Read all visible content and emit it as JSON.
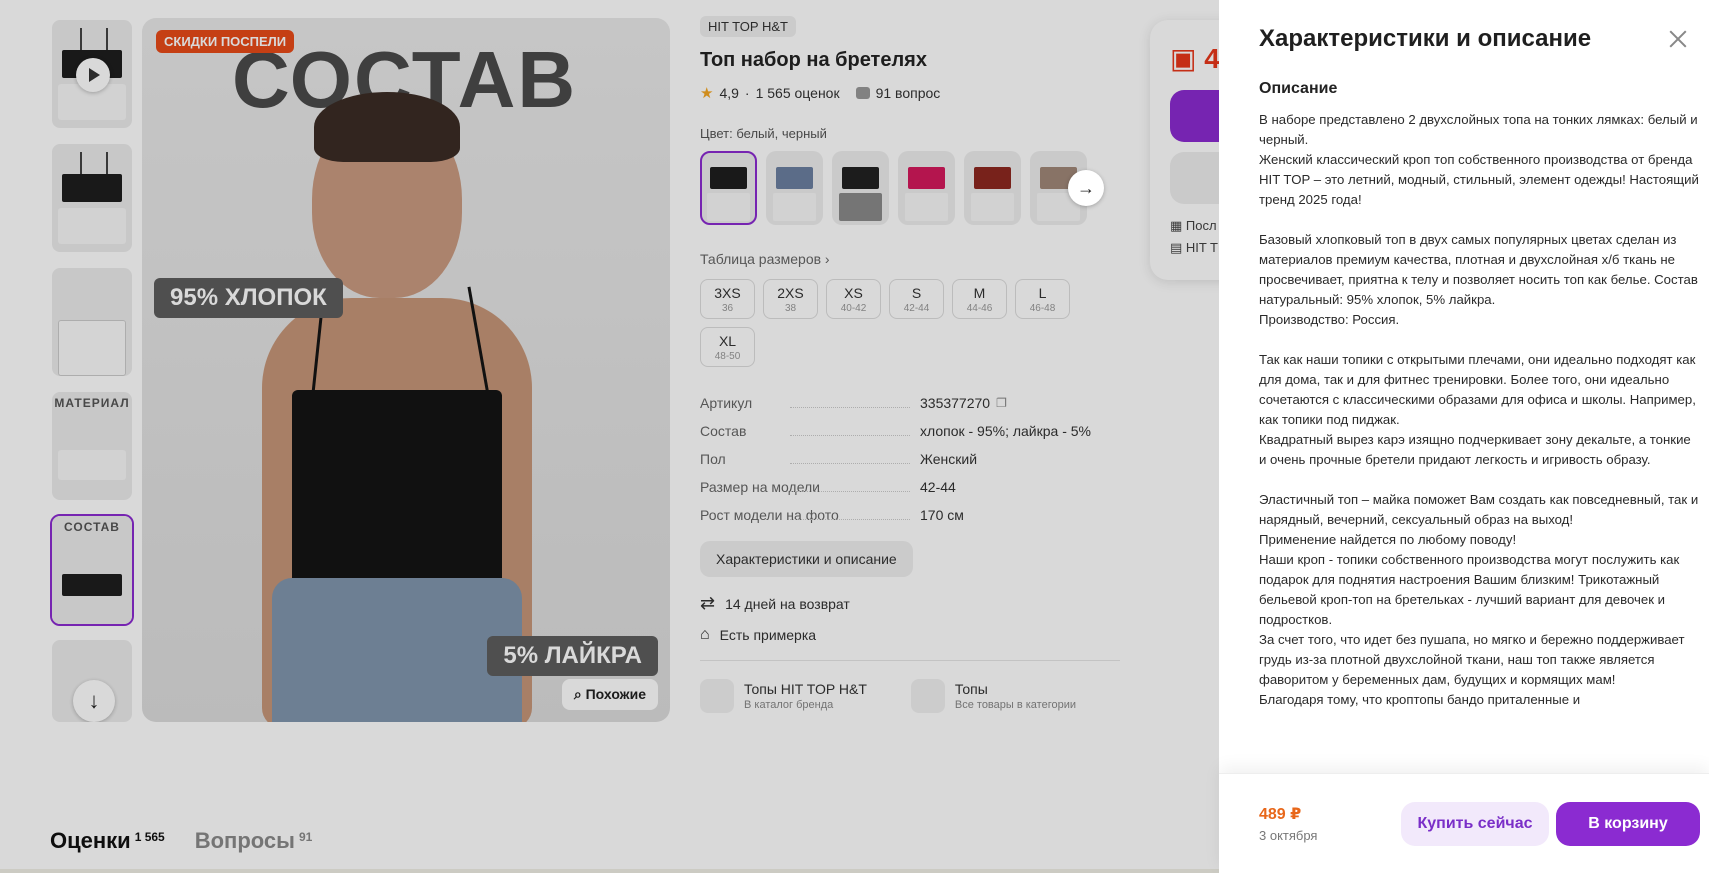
{
  "product": {
    "brand": "HIT TOP H&T",
    "title": "Топ набор на бретелях",
    "rating": "4,9",
    "ratings_count": "1 565 оценок",
    "questions": "91 вопрос",
    "color_label": "Цвет: белый, черный",
    "size_table_link": "Таблица размеров",
    "sizes": [
      {
        "size": "3XS",
        "ru": "36"
      },
      {
        "size": "2XS",
        "ru": "38"
      },
      {
        "size": "XS",
        "ru": "40-42"
      },
      {
        "size": "S",
        "ru": "42-44"
      },
      {
        "size": "M",
        "ru": "44-46"
      },
      {
        "size": "L",
        "ru": "46-48"
      },
      {
        "size": "XL",
        "ru": "48-50"
      }
    ],
    "swatch_colors": [
      "#1e1e1e",
      "#6c7fa0",
      "#222222",
      "#d4195c",
      "#8e2820",
      "#a08878"
    ],
    "specs": [
      {
        "key": "Артикул",
        "value": "335377270"
      },
      {
        "key": "Состав",
        "value": "хлопок - 95%; лайкра - 5%"
      },
      {
        "key": "Пол",
        "value": "Женский"
      },
      {
        "key": "Размер на модели",
        "value": "42-44"
      },
      {
        "key": "Рост модели на фото",
        "value": "170 см"
      }
    ],
    "desc_button": "Характеристики и описание",
    "features": [
      "14 дней на возврат",
      "Есть примерка"
    ],
    "links": [
      {
        "title": "Топы HIT TOP H&T",
        "sub": "В каталог бренда"
      },
      {
        "title": "Топы",
        "sub": "Все товары в категории"
      }
    ]
  },
  "hero": {
    "sale_tag": "СКИДКИ ПОСПЕЛИ",
    "title": "СОСТАВ",
    "badge_cotton": "95% ХЛОПОК",
    "badge_lycra": "5% ЛАЙКРА",
    "similar": "Похожие",
    "thumb_captions": [
      "МАТЕРИАЛ",
      "СОСТАВ"
    ]
  },
  "buybox": {
    "price_partial": "4",
    "line1": "Посл",
    "line2": "HIT T"
  },
  "bottom_tabs": {
    "reviews": "Оценки",
    "reviews_count": "1 565",
    "questions": "Вопросы",
    "questions_count": "91"
  },
  "drawer": {
    "title": "Характеристики и описание",
    "section": "Описание",
    "paragraphs": [
      [
        "В наборе представлено 2 двухслойных топа на тонких лямках: белый и черный.",
        "Женский классический кроп топ собственного производства от бренда HIT TOP – это летний, модный, стильный, элемент одежды! Настоящий тренд 2025 года!"
      ],
      [
        "Базовый хлопковый топ в двух самых популярных цветах сделан из материалов премиум качества, плотная и двухслойная х/б ткань не просвечивает, приятна к телу и позволяет носить топ как белье. Состав натуральный: 95% хлопок, 5% лайкра.",
        "Производство: Россия."
      ],
      [
        "Так как наши топики с открытыми плечами, они идеально подходят как для дома, так и для фитнес тренировки. Более того, они идеально сочетаются с классическими образами для офиса и школы. Например, как топики под пиджак.",
        "Квадратный вырез карэ изящно подчеркивает зону декальте, а тонкие и очень прочные бретели придают легкость и игривость образу."
      ],
      [
        "Эластичный топ – майка поможет Вам создать как повседневный, так и нарядный, вечерний, сексуальный образ на выход!",
        "Применение найдется по любому поводу!",
        "Наши кроп - топики собственного производства могут послужить как подарок для поднятия настроения Вашим близким! Трикотажный бельевой кроп-топ на бретельках - лучший вариант для девочек и подростков.",
        "За счет того, что идет без пушапа, но мягко и бережно поддерживает грудь из-за плотной двухслойной ткани, наш топ также является фаворитом у беременных дам, будущих и кормящих мам!",
        "Благодаря тому, что кроптопы бандо приталенные и"
      ]
    ],
    "footer_price": "489 ₽",
    "footer_date": "3 октября",
    "buy_now": "Купить сейчас",
    "add_to_cart": "В корзину"
  }
}
